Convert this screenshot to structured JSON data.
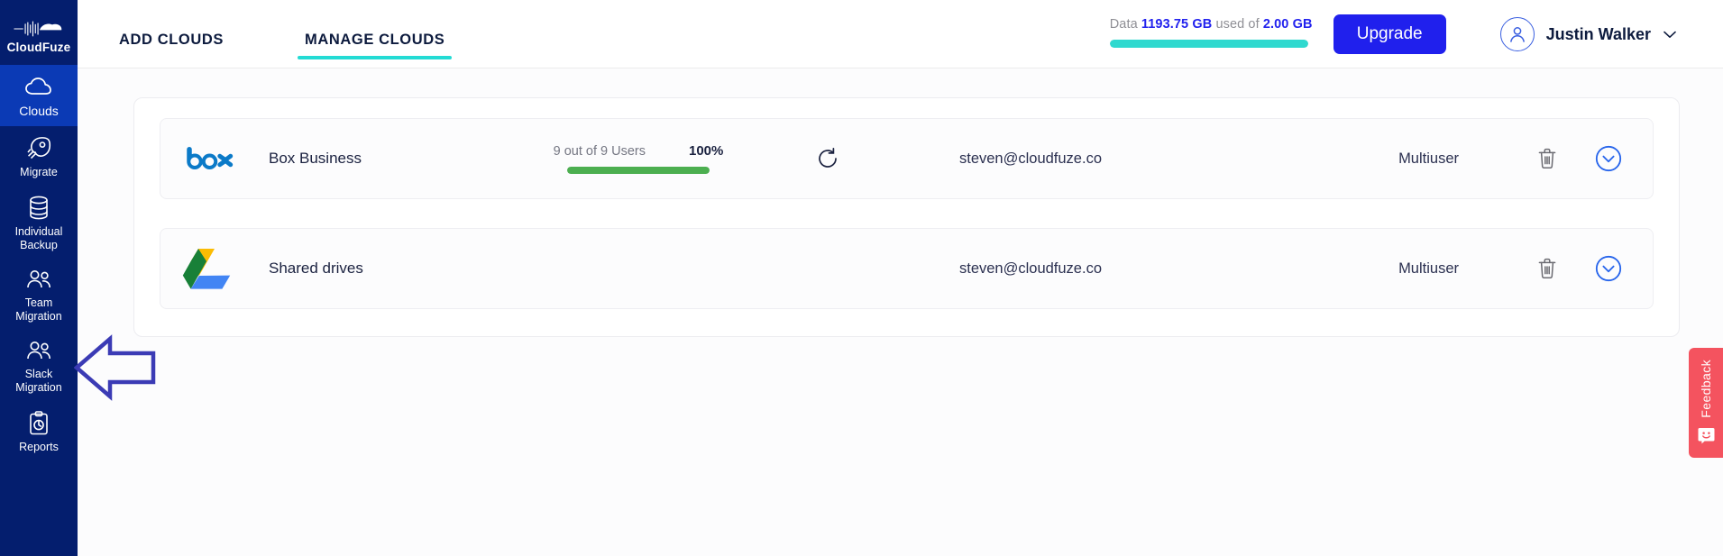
{
  "sidebar": {
    "brand": {
      "name": "CloudFuze",
      "logo_icon": "cloudfuze-logo-icon"
    },
    "items": [
      {
        "label": "Clouds",
        "icon": "cloud-icon",
        "active": true
      },
      {
        "label": "Migrate",
        "icon": "rocket-icon",
        "active": false
      },
      {
        "label": "Individual\nBackup",
        "line1": "Individual",
        "line2": "Backup",
        "icon": "database-icon",
        "active": false
      },
      {
        "label": "Team\nMigration",
        "line1": "Team",
        "line2": "Migration",
        "icon": "users-icon",
        "active": false
      },
      {
        "label": "Slack\nMigration",
        "line1": "Slack",
        "line2": "Migration",
        "icon": "users-icon",
        "active": false
      },
      {
        "label": "Reports",
        "icon": "clipboard-chart-icon",
        "active": false
      }
    ]
  },
  "topbar": {
    "tabs": [
      {
        "label": "ADD CLOUDS",
        "active": false
      },
      {
        "label": "MANAGE CLOUDS",
        "active": true
      }
    ],
    "data_usage": {
      "prefix": "Data ",
      "used": "1193.75 GB",
      "middle": " used of ",
      "total": "2.00 GB",
      "bar_percent": 100,
      "bar_color": "#2fd9cf"
    },
    "upgrade_label": "Upgrade",
    "user": {
      "name": "Justin Walker",
      "avatar_icon": "user-avatar-icon",
      "caret_icon": "chevron-down-icon"
    }
  },
  "clouds": [
    {
      "logo": "box-logo-icon",
      "name": "Box Business",
      "users_text": "9 out of 9 Users",
      "percent_label": "100%",
      "percent_value": 100,
      "progress_color": "#4caf50",
      "has_progress": true,
      "refresh_icon": "refresh-icon",
      "email": "steven@cloudfuze.co",
      "account_type": "Multiuser",
      "delete_icon": "trash-icon",
      "expand_icon": "chevron-down-circle-icon"
    },
    {
      "logo": "google-drive-logo-icon",
      "name": "Shared drives",
      "users_text": "",
      "percent_label": "",
      "percent_value": 0,
      "progress_color": "#4caf50",
      "has_progress": false,
      "refresh_icon": "refresh-icon",
      "email": "steven@cloudfuze.co",
      "account_type": "Multiuser",
      "delete_icon": "trash-icon",
      "expand_icon": "chevron-down-circle-icon"
    }
  ],
  "feedback": {
    "label": "Feedback",
    "icon": "smiley-face-icon",
    "color": "#f4535f"
  },
  "annotation": {
    "type": "left-arrow",
    "color": "#3b3bb5"
  }
}
